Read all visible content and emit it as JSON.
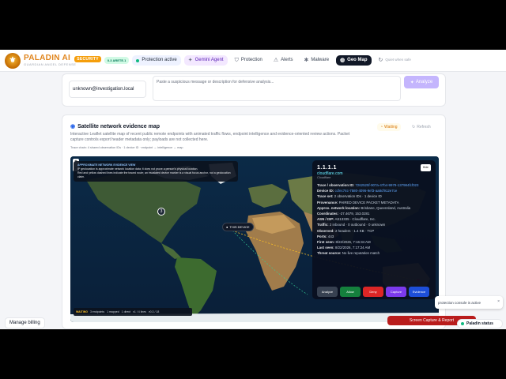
{
  "header": {
    "brand": "PALADIN",
    "brand_ai": "AI",
    "brand_tag": "SECURITY",
    "subtitle": "GUARDIAN ANGEL DEFENSE",
    "version": "0.3 ARETE.1",
    "nav": [
      {
        "label": "Protection active",
        "icon": "shield-dot-icon"
      },
      {
        "label": "Gemini Agent",
        "icon": "sparkle-icon"
      },
      {
        "label": "Protection",
        "icon": "shield-icon"
      },
      {
        "label": "Alerts",
        "icon": "alert-icon"
      },
      {
        "label": "Malware",
        "icon": "bug-icon"
      },
      {
        "label": "Geo Map",
        "icon": "globe-icon"
      },
      {
        "label": "Quiet when safe",
        "icon": "refresh-icon"
      }
    ]
  },
  "analyze": {
    "email_value": "unknown@investigation.local",
    "message_placeholder": "Paste a suspicious message or description for defensive analysis...",
    "analyze_label": "Analyze"
  },
  "map_card": {
    "title": "Satellite network evidence map",
    "description": "Interactive Leaflet satellite map of recent public remote endpoints with animated traffic flows, endpoint intelligence and evidence-oriented review actions. Packet capture controls export header metadata only; payloads are not collected here.",
    "chain": "Trace chain: 4 shared observation IDs · 1 device ID · endpoint → intelligence → map",
    "waiting": "Waiting",
    "refresh": "Refresh",
    "tip_title": "APPROXIMATE NETWORK EVIDENCE VIEW",
    "tip_line1": "IP geolocation is approximate network location data; it does not prove a person's physical location.",
    "tip_line2": "Red and yellow dashed lines indicate the traced route; an escalated device marker is a visual focus anchor, not a geolocation claim.",
    "cluster_count": "3",
    "this_device": "THIS DEVICE",
    "status_waiting": "WAITING",
    "status_items": [
      "3 endpoints",
      "1 mapped",
      "1 direct",
      "v1 / 4 lines",
      "v0.3 / 18"
    ],
    "attribution": "Leaflet | Tiles © Esri"
  },
  "detail": {
    "ip": "1.1.1.1",
    "host": "cloudflare.com",
    "host_sub": "Cloudflare",
    "close_label": "Hide",
    "rows": [
      {
        "k": "Trace / observation ID:",
        "v": "7262525f-907a-47b4-9979-137984fcf023",
        "hl": true
      },
      {
        "k": "Device ID:",
        "v": "ccfec74c-7580-4096-9ef3-aa8cf912e7ce",
        "hl": true
      },
      {
        "k": "Trace set:",
        "v": "2 observation IDs · 1 device ID",
        "hl": false
      },
      {
        "k": "Provenance:",
        "v": "PAIRED DEVICE PACKET METADATA",
        "hl": false
      },
      {
        "k": "Approx. network location:",
        "v": "Brisbane, Queensland, Australia",
        "hl": false
      },
      {
        "k": "Coordinates:",
        "v": "-27.4679, 153.0281",
        "hl": false
      },
      {
        "k": "ASN / ISP:",
        "v": "AS13335 · Cloudflare, Inc.",
        "hl": false
      },
      {
        "k": "Traffic:",
        "v": "2 inbound · 0 outbound · 0 unknown",
        "hl": false
      },
      {
        "k": "Observed:",
        "v": "2 headers · 1.4 KB · TCP",
        "hl": false
      },
      {
        "k": "Ports:",
        "v": "443",
        "hl": false
      },
      {
        "k": "First seen:",
        "v": "8/22/2026, 7:16:34 AM",
        "hl": false
      },
      {
        "k": "Last seen:",
        "v": "8/22/2026, 7:17:24 AM",
        "hl": false
      },
      {
        "k": "Threat source:",
        "v": "No live reputation match",
        "hl": false
      }
    ],
    "actions": [
      "Analyze",
      "Allow",
      "Deny",
      "Capture",
      "Evidence"
    ]
  },
  "footer": {
    "manage_billing": "Manage billing",
    "toast": "protection console is active",
    "report": "Screen Capture & Report",
    "paladin_status": "Paladin status"
  }
}
